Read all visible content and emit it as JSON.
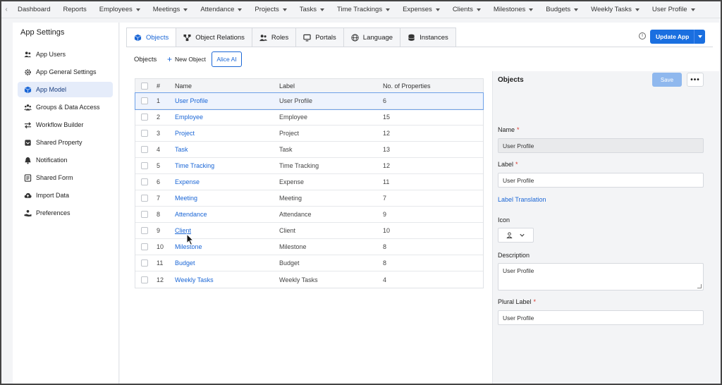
{
  "topnav": {
    "items": [
      {
        "label": "Dashboard",
        "dropdown": false
      },
      {
        "label": "Reports",
        "dropdown": false
      },
      {
        "label": "Employees",
        "dropdown": true
      },
      {
        "label": "Meetings",
        "dropdown": true
      },
      {
        "label": "Attendance",
        "dropdown": true
      },
      {
        "label": "Projects",
        "dropdown": true
      },
      {
        "label": "Tasks",
        "dropdown": true
      },
      {
        "label": "Time Trackings",
        "dropdown": true
      },
      {
        "label": "Expenses",
        "dropdown": true
      },
      {
        "label": "Clients",
        "dropdown": true
      },
      {
        "label": "Milestones",
        "dropdown": true
      },
      {
        "label": "Budgets",
        "dropdown": true
      },
      {
        "label": "Weekly Tasks",
        "dropdown": true
      },
      {
        "label": "User Profile",
        "dropdown": true
      }
    ]
  },
  "sidebar": {
    "title": "App Settings",
    "items": [
      {
        "label": "App Users",
        "icon": "users-icon",
        "active": false
      },
      {
        "label": "App General Settings",
        "icon": "gear-icon",
        "active": false
      },
      {
        "label": "App Model",
        "icon": "cube-icon",
        "active": true
      },
      {
        "label": "Groups & Data Access",
        "icon": "group-icon",
        "active": false
      },
      {
        "label": "Workflow Builder",
        "icon": "arrows-icon",
        "active": false
      },
      {
        "label": "Shared Property",
        "icon": "shared-property-icon",
        "active": false
      },
      {
        "label": "Notification",
        "icon": "bell-icon",
        "active": false
      },
      {
        "label": "Shared Form",
        "icon": "form-icon",
        "active": false
      },
      {
        "label": "Import Data",
        "icon": "cloud-upload-icon",
        "active": false
      },
      {
        "label": "Preferences",
        "icon": "hand-icon",
        "active": false
      }
    ]
  },
  "tabs": [
    {
      "label": "Objects",
      "icon": "cube-icon",
      "active": true
    },
    {
      "label": "Object Relations",
      "icon": "relations-icon",
      "active": false
    },
    {
      "label": "Roles",
      "icon": "roles-icon",
      "active": false
    },
    {
      "label": "Portals",
      "icon": "monitor-icon",
      "active": false
    },
    {
      "label": "Language",
      "icon": "globe-icon",
      "active": false
    },
    {
      "label": "Instances",
      "icon": "database-icon",
      "active": false
    }
  ],
  "header": {
    "update_app_label": "Update App",
    "info_glyph": "i"
  },
  "toolbar": {
    "title": "Objects",
    "new_object_label": "New Object",
    "alice_ai_label": "Alice AI"
  },
  "table": {
    "columns": [
      "#",
      "Name",
      "Label",
      "No. of Properties"
    ],
    "rows": [
      {
        "num": "1",
        "name": "User Profile",
        "label": "User Profile",
        "props": "6"
      },
      {
        "num": "2",
        "name": "Employee",
        "label": "Employee",
        "props": "15"
      },
      {
        "num": "3",
        "name": "Project",
        "label": "Project",
        "props": "12"
      },
      {
        "num": "4",
        "name": "Task",
        "label": "Task",
        "props": "13"
      },
      {
        "num": "5",
        "name": "Time Tracking",
        "label": "Time Tracking",
        "props": "12"
      },
      {
        "num": "6",
        "name": "Expense",
        "label": "Expense",
        "props": "11"
      },
      {
        "num": "7",
        "name": "Meeting",
        "label": "Meeting",
        "props": "7"
      },
      {
        "num": "8",
        "name": "Attendance",
        "label": "Attendance",
        "props": "9"
      },
      {
        "num": "9",
        "name": "Client",
        "label": "Client",
        "props": "10"
      },
      {
        "num": "10",
        "name": "Milestone",
        "label": "Milestone",
        "props": "8"
      },
      {
        "num": "11",
        "name": "Budget",
        "label": "Budget",
        "props": "8"
      },
      {
        "num": "12",
        "name": "Weekly Tasks",
        "label": "Weekly Tasks",
        "props": "4"
      }
    ],
    "selected_index": 0,
    "hovered_index": 8
  },
  "panel": {
    "title": "Objects",
    "save_label": "Save",
    "more_label": "•••",
    "name_label": "Name",
    "name_value": "User Profile",
    "label_label": "Label",
    "label_value": "User Profile",
    "label_translation_link": "Label Translation",
    "icon_label": "Icon",
    "description_label": "Description",
    "description_value": "User Profile",
    "plural_label_label": "Plural Label",
    "plural_label_value": "User Profile",
    "required_mark": "*"
  },
  "colors": {
    "accent": "#1a6fe0",
    "link": "#1a66d6",
    "required": "#d9342b",
    "active_sidebar_bg": "#e5ecfa",
    "save_disabled": "#8fb8ee"
  }
}
